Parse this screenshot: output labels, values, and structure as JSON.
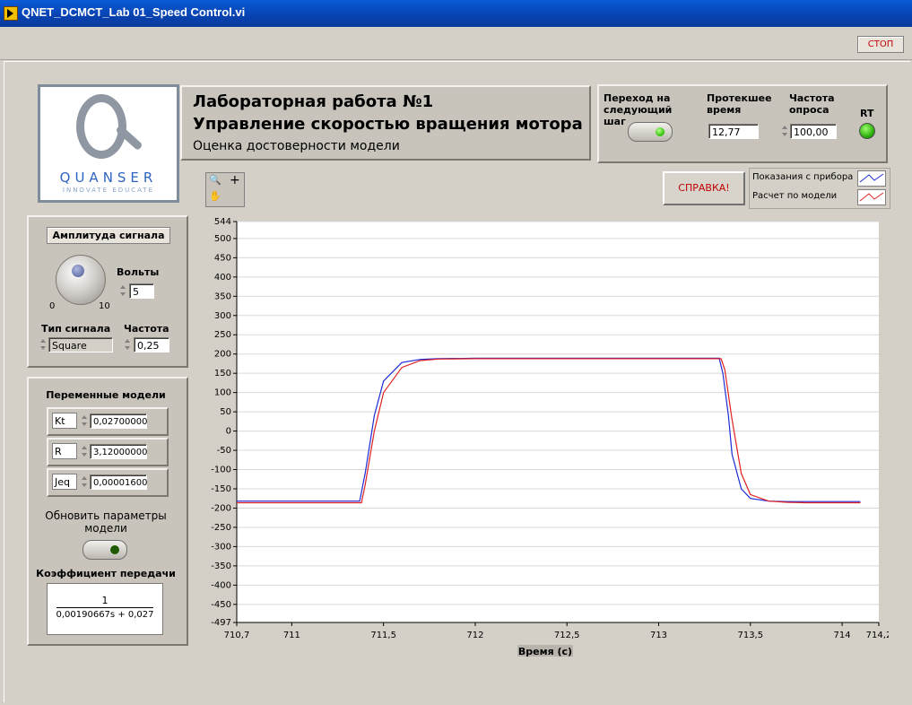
{
  "window": {
    "title": "QNET_DCMCT_Lab 01_Speed Control.vi"
  },
  "stop_button": {
    "label": "СТОП"
  },
  "logo": {
    "brand": "QUANSER",
    "tagline": "INNOVATE EDUCATE"
  },
  "header": {
    "line1": "Лабораторная работа №1",
    "line2": "Управление скоростью вращения мотора",
    "line3": "Оценка достоверности модели"
  },
  "status": {
    "next_step_label": "Переход на следующий шаг",
    "elapsed_label": "Протекшее время",
    "elapsed_value": "12,77",
    "rate_label": "Частота опроса",
    "rate_value": "100,00",
    "rt_label": "RT",
    "colors": {
      "next_led": "#29c000",
      "rt_led": "#1ea400"
    }
  },
  "help_button": {
    "label": "СПРАВКА!"
  },
  "legend": {
    "items": [
      {
        "label": "Показания с прибора",
        "color": "#1c2bd6"
      },
      {
        "label": "Расчет по модели",
        "color": "#e02020"
      }
    ]
  },
  "signal": {
    "amplitude_button": "Амплитуда сигнала",
    "knob_min": "0",
    "knob_max": "10",
    "volts_label": "Вольты",
    "volts_value": "5",
    "type_label": "Тип сигнала",
    "type_value": "Square",
    "freq_label": "Частота",
    "freq_value": "0,25"
  },
  "model": {
    "title": "Переменные модели",
    "vars": [
      {
        "name": "Kt",
        "value": "0,02700000"
      },
      {
        "name": "R",
        "value": "3,12000000"
      },
      {
        "name": "Jeq",
        "value": "0,00001600"
      }
    ],
    "update_label": "Обновить параметры модели",
    "update_led_color": "#1f5a00",
    "gain_label": "Коэффициент передачи",
    "tf_numerator": "1",
    "tf_denominator": "0,00190667s + 0,027"
  },
  "chart_data": {
    "type": "line",
    "title": "",
    "xlabel": "Время (с)",
    "ylabel": "",
    "xlim": [
      710.7,
      714.2
    ],
    "ylim": [
      -497,
      544
    ],
    "x_ticks": [
      "710,7",
      "711",
      "711,5",
      "712",
      "712,5",
      "713",
      "713,5",
      "714",
      "714,2"
    ],
    "x_tick_values": [
      710.7,
      711,
      711.5,
      712,
      712.5,
      713,
      713.5,
      714,
      714.2
    ],
    "y_ticks": [
      "544",
      "500",
      "450",
      "400",
      "350",
      "300",
      "250",
      "200",
      "150",
      "100",
      "50",
      "0",
      "-50",
      "-100",
      "-150",
      "-200",
      "-250",
      "-300",
      "-350",
      "-400",
      "-450",
      "-497"
    ],
    "y_tick_values": [
      544,
      500,
      450,
      400,
      350,
      300,
      250,
      200,
      150,
      100,
      50,
      0,
      -50,
      -100,
      -150,
      -200,
      -250,
      -300,
      -350,
      -400,
      -450,
      -497
    ],
    "grid": true,
    "series": [
      {
        "name": "Показания с прибора",
        "color": "#1c2bd6",
        "x": [
          710.7,
          711.0,
          711.3,
          711.35,
          711.37,
          711.4,
          711.45,
          711.5,
          711.6,
          711.7,
          711.8,
          712.0,
          712.5,
          713.0,
          713.33,
          713.35,
          713.38,
          713.4,
          713.45,
          713.5,
          713.6,
          713.7,
          713.8,
          714.0,
          714.1
        ],
        "y": [
          -182,
          -182,
          -182,
          -182,
          -182,
          -110,
          40,
          130,
          178,
          186,
          188,
          189,
          189,
          189,
          189,
          150,
          40,
          -60,
          -150,
          -175,
          -182,
          -183,
          -183,
          -183,
          -183
        ]
      },
      {
        "name": "Расчет по модели",
        "color": "#e02020",
        "x": [
          710.7,
          711.0,
          711.3,
          711.36,
          711.38,
          711.4,
          711.45,
          711.5,
          711.6,
          711.7,
          711.8,
          712.0,
          712.5,
          713.0,
          713.34,
          713.36,
          713.4,
          713.45,
          713.5,
          713.6,
          713.7,
          713.8,
          714.0,
          714.1
        ],
        "y": [
          -186,
          -186,
          -186,
          -186,
          -186,
          -140,
          0,
          100,
          165,
          183,
          187,
          188,
          188,
          188,
          188,
          160,
          30,
          -110,
          -165,
          -182,
          -185,
          -186,
          -186,
          -186
        ]
      }
    ]
  }
}
